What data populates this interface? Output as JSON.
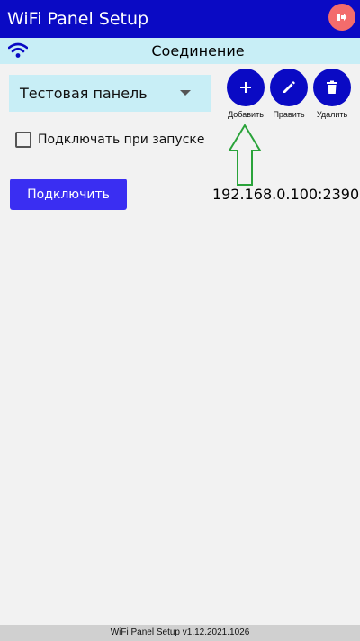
{
  "app_bar": {
    "title": "WiFi Panel Setup",
    "exit_icon": "exit-icon"
  },
  "connection": {
    "title": "Соединение",
    "icon": "wifi-icon"
  },
  "panel_select": {
    "value": "Тестовая панель"
  },
  "actions": [
    {
      "label": "Добавить",
      "icon": "plus-icon"
    },
    {
      "label": "Править",
      "icon": "pencil-icon"
    },
    {
      "label": "Удалить",
      "icon": "trash-icon"
    }
  ],
  "autoconnect": {
    "label": "Подключать при запуске",
    "checked": false
  },
  "connect_button": {
    "label": "Подключить"
  },
  "address": "192.168.0.100:2390",
  "footer": {
    "text": "WiFi Panel Setup v1.12.2021.1026"
  },
  "colors": {
    "primary": "#0a0ac4",
    "accent_light": "#c8eef6",
    "exit": "#f36c6c",
    "connect": "#3a2ef2",
    "annotation": "#2aa33a",
    "background": "#f2f2f2"
  }
}
